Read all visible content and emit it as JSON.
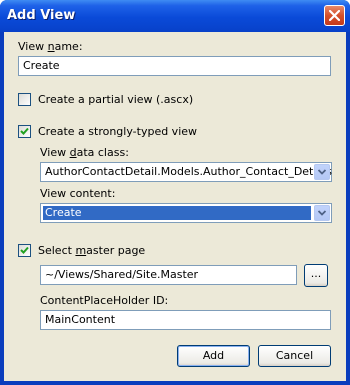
{
  "window": {
    "title": "Add View",
    "close_icon": "close-icon"
  },
  "view_name": {
    "label_pre": "View ",
    "label_accel": "n",
    "label_post": "ame:",
    "value": "Create"
  },
  "partial_view": {
    "label": "Create a partial view (.ascx)",
    "checked": false
  },
  "strongly_typed": {
    "label": "Create a strongly-typed view",
    "checked": true,
    "data_class_label_pre": "View ",
    "data_class_label_accel": "d",
    "data_class_label_post": "ata class:",
    "data_class_value": "AuthorContactDetail.Models.Author_Contact_Details",
    "content_label": "View content:",
    "content_value": "Create"
  },
  "master_page": {
    "label_pre": "Select ",
    "label_accel": "m",
    "label_post": "aster page",
    "checked": true,
    "path_value": "~/Views/Shared/Site.Master",
    "browse_label": "...",
    "placeholder_label": "ContentPlaceHolder ID:",
    "placeholder_value": "MainContent"
  },
  "buttons": {
    "add": "Add",
    "cancel": "Cancel"
  }
}
